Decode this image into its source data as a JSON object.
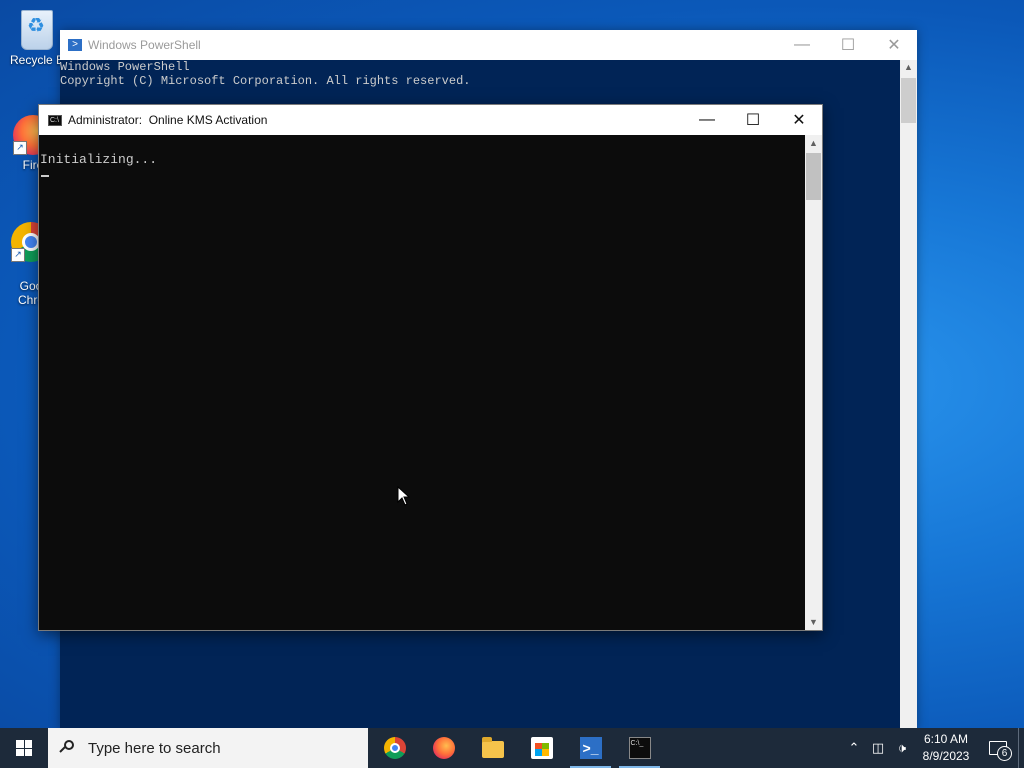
{
  "desktop": {
    "icons": [
      {
        "label": "Recycle B"
      },
      {
        "label": "Fire"
      },
      {
        "label": "Goo\nChro"
      }
    ]
  },
  "powershell_window": {
    "title": "Windows PowerShell",
    "console_lines": [
      "Windows PowerShell",
      "Copyright (C) Microsoft Corporation. All rights reserved."
    ],
    "accent": "#012456"
  },
  "cmd_window": {
    "title": "Administrator:  Online KMS Activation",
    "console_text": "Initializing...",
    "background": "#0c0c0c"
  },
  "taskbar": {
    "search_placeholder": "Type here to search",
    "pinned_apps": [
      "chrome-icon",
      "firefox-icon",
      "file-explorer-icon",
      "microsoft-store-icon",
      "powershell-icon",
      "command-prompt-icon"
    ],
    "clock": {
      "time": "6:10 AM",
      "date": "8/9/2023"
    },
    "notification_count": "6"
  }
}
